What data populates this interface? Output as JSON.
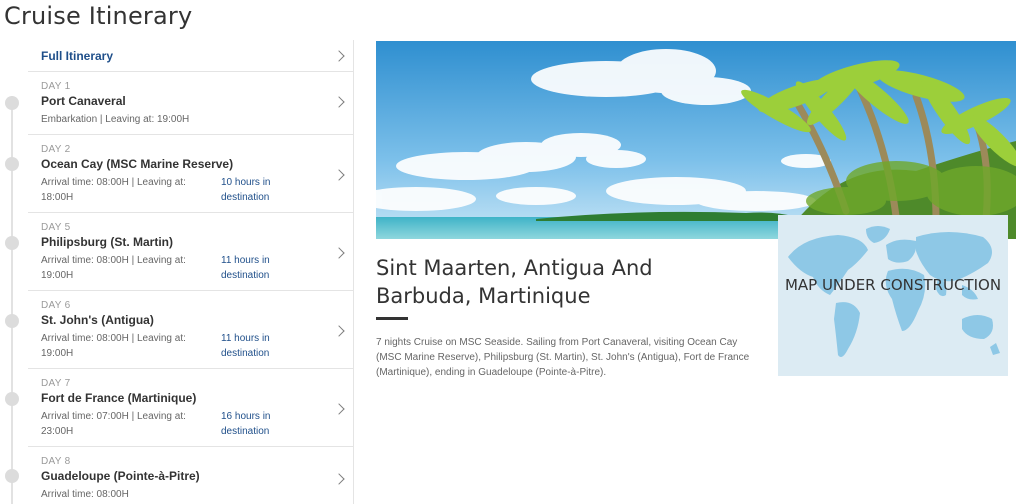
{
  "page_title": "Cruise Itinerary",
  "full_itinerary_label": "Full Itinerary",
  "days": [
    {
      "day": "DAY 1",
      "port": "Port Canaveral",
      "info": "Embarkation | Leaving at: 19:00H",
      "duration": ""
    },
    {
      "day": "DAY 2",
      "port": "Ocean Cay (MSC Marine Reserve)",
      "info": "Arrival time: 08:00H | Leaving at: 18:00H",
      "duration": "10 hours in destination"
    },
    {
      "day": "DAY 5",
      "port": "Philipsburg (St. Martin)",
      "info": "Arrival time: 08:00H | Leaving at: 19:00H",
      "duration": "11 hours in destination"
    },
    {
      "day": "DAY 6",
      "port": "St. John's (Antigua)",
      "info": "Arrival time: 08:00H | Leaving at: 19:00H",
      "duration": "11 hours in destination"
    },
    {
      "day": "DAY 7",
      "port": "Fort de France (Martinique)",
      "info": "Arrival time: 07:00H | Leaving at: 23:00H",
      "duration": "16 hours in destination"
    },
    {
      "day": "DAY 8",
      "port": "Guadeloupe (Pointe-à-Pitre)",
      "info": "Arrival time: 08:00H",
      "duration": ""
    }
  ],
  "map_text": "MAP UNDER CONSTRUCTION",
  "cruise_title": "Sint Maarten, Antigua And Barbuda, Martinique",
  "description": "7 nights Cruise on MSC Seaside. Sailing from Port Canaveral, visiting Ocean Cay (MSC Marine Reserve), Philipsburg (St. Martin), St. John's (Antigua), Fort de France (Martinique), ending in Guadeloupe (Pointe-à-Pitre).",
  "icons": {
    "chevron": "chevron-right-icon",
    "timeline_dot": "timeline-dot",
    "map": "world-map-icon"
  }
}
